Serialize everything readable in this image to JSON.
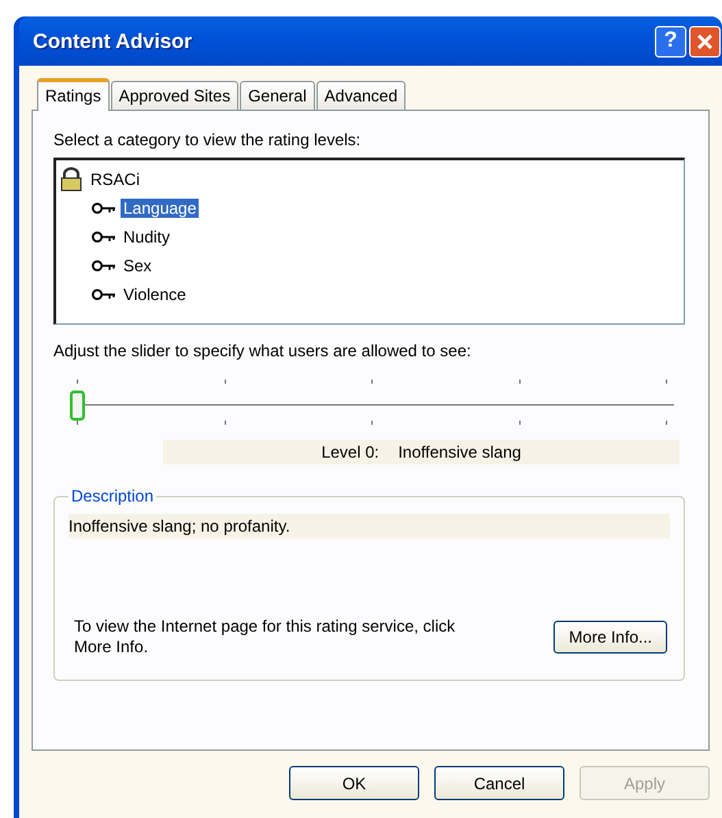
{
  "window": {
    "title": "Content Advisor",
    "help_button": "?"
  },
  "tabs": [
    {
      "label": "Ratings",
      "selected": true
    },
    {
      "label": "Approved Sites",
      "selected": false
    },
    {
      "label": "General",
      "selected": false
    },
    {
      "label": "Advanced",
      "selected": false
    }
  ],
  "ratings": {
    "category_prompt": "Select a category to view the rating levels:",
    "tree": [
      {
        "label": "RSACi",
        "selected": false,
        "children": [
          {
            "label": "Language",
            "selected": true
          },
          {
            "label": "Nudity",
            "selected": false
          },
          {
            "label": "Sex",
            "selected": false
          },
          {
            "label": "Violence",
            "selected": false
          }
        ]
      }
    ],
    "slider_prompt": "Adjust the slider to specify what users are allowed to see:",
    "slider": {
      "level": 0
    },
    "level_label": "Level 0:",
    "level_name": "Inoffensive slang",
    "description": {
      "legend": "Description",
      "text": "Inoffensive slang; no profanity.",
      "info_text": "To view the Internet page for this rating service, click More Info.",
      "more_info_button": "More Info..."
    }
  },
  "buttons": [
    {
      "label": "OK",
      "disabled": false
    },
    {
      "label": "Cancel",
      "disabled": false
    },
    {
      "label": "Apply",
      "disabled": true
    }
  ]
}
